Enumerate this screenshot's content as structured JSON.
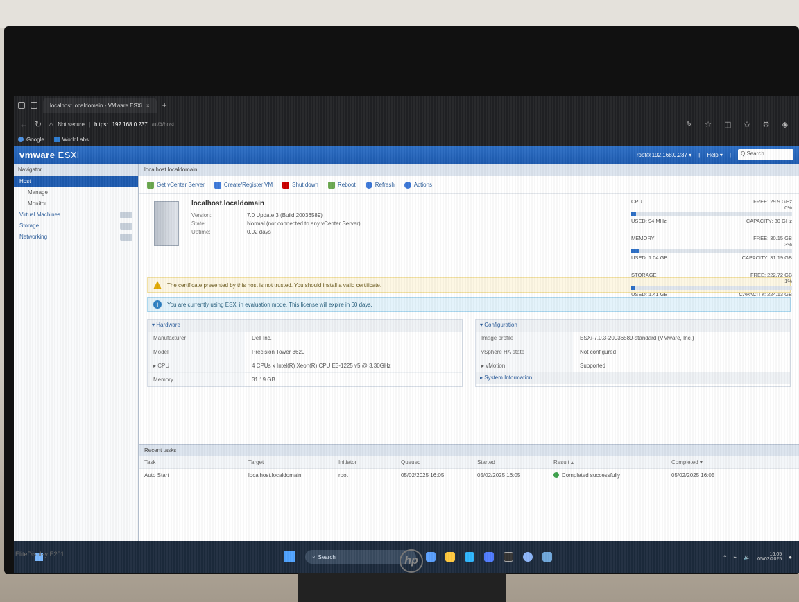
{
  "monitor": {
    "brand_label": "EliteDisplay E201",
    "hp_logo": "hp"
  },
  "browser": {
    "tab_title": "localhost.localdomain - VMware ESXi",
    "tab_close": "×",
    "new_tab": "+",
    "security_label": "Not secure",
    "url_scheme": "https:",
    "url_host": "192.168.0.237",
    "url_path": "/ui/#/host",
    "bookmarks": [
      {
        "label": "Google",
        "icon": "google-icon"
      },
      {
        "label": "WorldLabs",
        "icon": "bookmark-icon"
      }
    ]
  },
  "esxi": {
    "logo_brand": "vmware",
    "logo_product": " ESXi",
    "user_menu": "root@192.168.0.237 ▾",
    "help_menu": "Help ▾",
    "search_placeholder": "Q Search",
    "navigator_title": "Navigator",
    "nav_items": [
      {
        "label": "Host",
        "active": true
      },
      {
        "label": "Manage",
        "sub": true
      },
      {
        "label": "Monitor",
        "sub": true
      },
      {
        "label": "Virtual Machines"
      },
      {
        "label": "Storage"
      },
      {
        "label": "Networking"
      }
    ],
    "main_title": "localhost.localdomain",
    "toolbar": [
      "Get vCenter Server",
      "Create/Register VM",
      "Shut down",
      "Reboot",
      "Refresh",
      "Actions"
    ],
    "host": {
      "name": "localhost.localdomain",
      "version_key": "Version:",
      "version_val": "7.0 Update 3 (Build 20036589)",
      "state_key": "State:",
      "state_val": "Normal (not connected to any vCenter Server)",
      "uptime_key": "Uptime:",
      "uptime_val": "0.02 days"
    },
    "gauges": [
      {
        "name": "CPU",
        "free": "FREE: 29.9 GHz",
        "pct_label": "0%",
        "used": "USED: 94 MHz",
        "capacity": "CAPACITY: 30 GHz",
        "fill": 0.03
      },
      {
        "name": "MEMORY",
        "free": "FREE: 30.15 GB",
        "pct_label": "3%",
        "used": "USED: 1.04 GB",
        "capacity": "CAPACITY: 31.19 GB",
        "fill": 0.05
      },
      {
        "name": "STORAGE",
        "free": "FREE: 222.72 GB",
        "pct_label": "1%",
        "used": "USED: 1.41 GB",
        "capacity": "CAPACITY: 224.13 GB",
        "fill": 0.02
      }
    ],
    "alerts": {
      "warning": "The certificate presented by this host is not trusted. You should install a valid certificate.",
      "info": "You are currently using ESXi in evaluation mode. This license will expire in 60 days."
    },
    "hardware": {
      "title": "▾ Hardware",
      "rows": [
        {
          "k": "Manufacturer",
          "v": "Dell Inc."
        },
        {
          "k": "Model",
          "v": "Precision Tower 3620"
        },
        {
          "k": "▸ CPU",
          "v": "4 CPUs x Intel(R) Xeon(R) CPU E3-1225 v5 @ 3.30GHz"
        },
        {
          "k": "Memory",
          "v": "31.19 GB"
        }
      ]
    },
    "configuration": {
      "title": "▾ Configuration",
      "rows": [
        {
          "k": "Image profile",
          "v": "ESXi-7.0.3-20036589-standard (VMware, Inc.)"
        },
        {
          "k": "vSphere HA state",
          "v": "Not configured"
        },
        {
          "k": "▸ vMotion",
          "v": "Supported"
        }
      ],
      "system_info": "▸ System Information"
    },
    "recent_tasks": {
      "title": "Recent tasks",
      "headers": [
        "Task",
        "Target",
        "Initiator",
        "Queued",
        "Started",
        "Result ▴",
        "Completed ▾"
      ],
      "rows": [
        [
          "Auto Start",
          "localhost.localdomain",
          "root",
          "05/02/2025 16:05",
          "05/02/2025 16:05",
          "Completed successfully",
          "05/02/2025 16:05"
        ]
      ]
    }
  },
  "taskbar": {
    "search": "Search",
    "tray_time": "16:05",
    "tray_date": "05/02/2025"
  }
}
